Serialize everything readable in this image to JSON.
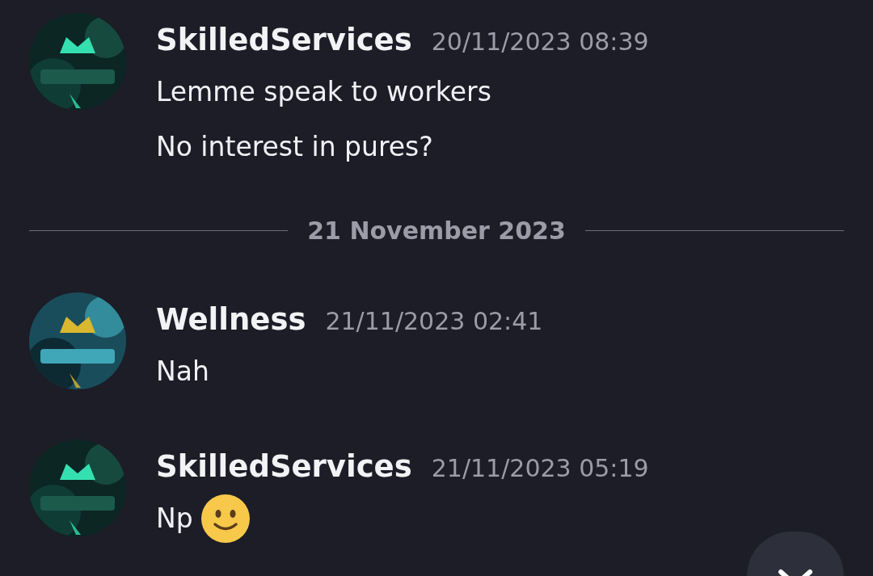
{
  "messages": [
    {
      "kind": "message",
      "author": "SkilledServices",
      "timestamp": "20/11/2023 08:39",
      "avatar": {
        "kind": "picture"
      },
      "lines": [
        {
          "text": "Lemme speak to workers"
        },
        {
          "text": "No interest in pures?"
        }
      ]
    },
    {
      "kind": "divider",
      "label": "21 November 2023"
    },
    {
      "kind": "message",
      "author": "Wellness",
      "timestamp": "21/11/2023 02:41",
      "avatar": {
        "kind": "picture"
      },
      "lines": [
        {
          "text": "Nah"
        }
      ]
    },
    {
      "kind": "message",
      "author": "SkilledServices",
      "timestamp": "21/11/2023 05:19",
      "avatar": {
        "kind": "picture"
      },
      "lines": [
        {
          "text": "Np",
          "emoji": true
        }
      ]
    }
  ]
}
